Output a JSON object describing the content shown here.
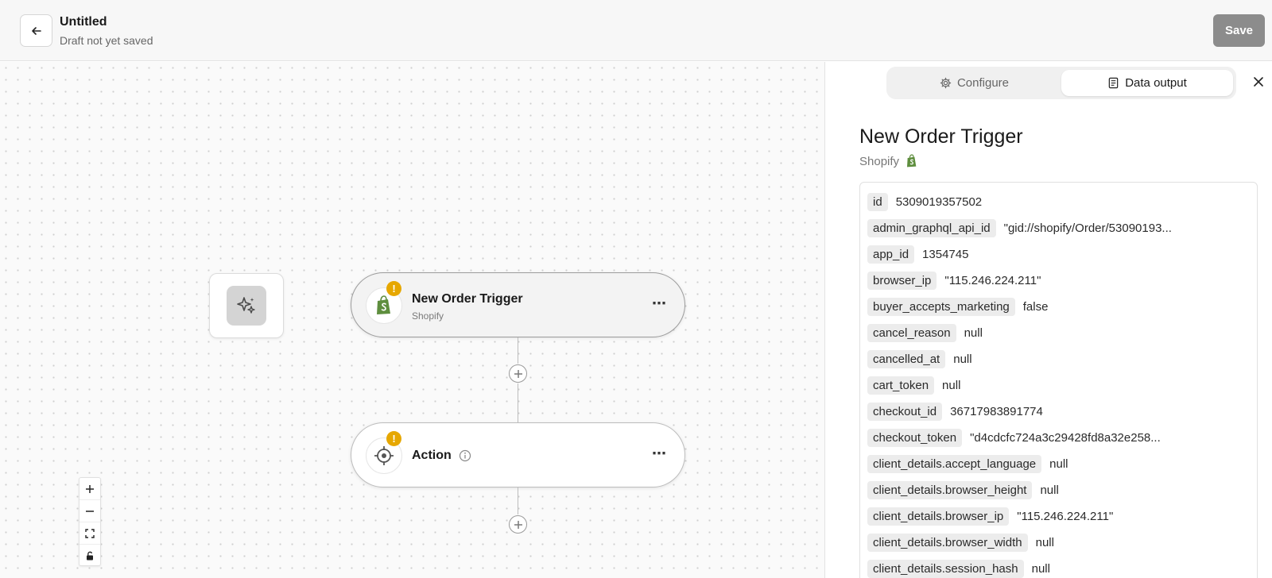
{
  "header": {
    "title": "Untitled",
    "subtitle": "Draft not yet saved",
    "save_label": "Save"
  },
  "canvas": {
    "trigger_node": {
      "title": "New Order Trigger",
      "subtitle": "Shopify",
      "warning": "!"
    },
    "action_node": {
      "title": "Action",
      "warning": "!"
    },
    "more_label": "⋯"
  },
  "panel": {
    "tabs": {
      "configure": "Configure",
      "output": "Data output"
    },
    "title": "New Order Trigger",
    "app": "Shopify",
    "rows": [
      {
        "key": "id",
        "value": "5309019357502"
      },
      {
        "key": "admin_graphql_api_id",
        "value": "\"gid://shopify/Order/53090193..."
      },
      {
        "key": "app_id",
        "value": "1354745"
      },
      {
        "key": "browser_ip",
        "value": "\"115.246.224.211\""
      },
      {
        "key": "buyer_accepts_marketing",
        "value": "false"
      },
      {
        "key": "cancel_reason",
        "value": "null"
      },
      {
        "key": "cancelled_at",
        "value": "null"
      },
      {
        "key": "cart_token",
        "value": "null"
      },
      {
        "key": "checkout_id",
        "value": "36717983891774"
      },
      {
        "key": "checkout_token",
        "value": "\"d4cdcfc724a3c29428fd8a32e258..."
      },
      {
        "key": "client_details.accept_language",
        "value": "null"
      },
      {
        "key": "client_details.browser_height",
        "value": "null"
      },
      {
        "key": "client_details.browser_ip",
        "value": "\"115.246.224.211\""
      },
      {
        "key": "client_details.browser_width",
        "value": "null"
      },
      {
        "key": "client_details.session_hash",
        "value": "null"
      }
    ]
  },
  "colors": {
    "shopify_green": "#5e8e3e",
    "warning": "#e6a700",
    "save_disabled": "#8c8c8c"
  }
}
